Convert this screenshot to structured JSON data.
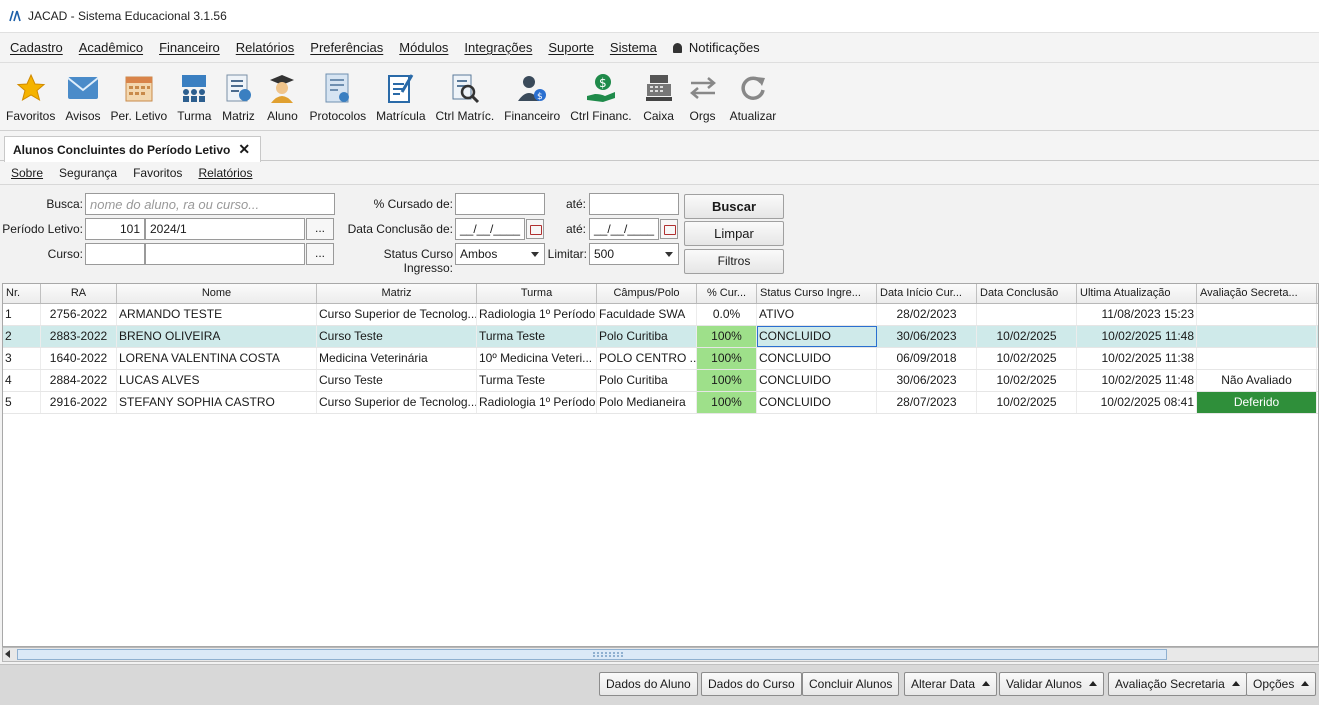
{
  "window": {
    "title": "JACAD - Sistema Educacional 3.1.56"
  },
  "menu": [
    "Cadastro",
    "Acadêmico",
    "Financeiro",
    "Relatórios",
    "Preferências",
    "Módulos",
    "Integrações",
    "Suporte",
    "Sistema"
  ],
  "notifications_label": "Notificações",
  "toolbar": [
    {
      "label": "Favoritos",
      "icon": "star-icon"
    },
    {
      "label": "Avisos",
      "icon": "envelope-icon"
    },
    {
      "label": "Per. Letivo",
      "icon": "calendar-icon"
    },
    {
      "label": "Turma",
      "icon": "class-icon"
    },
    {
      "label": "Matriz",
      "icon": "curriculum-icon"
    },
    {
      "label": "Aluno",
      "icon": "student-icon"
    },
    {
      "label": "Protocolos",
      "icon": "protocol-icon"
    },
    {
      "label": "Matrícula",
      "icon": "enrollment-icon"
    },
    {
      "label": "Ctrl Matríc.",
      "icon": "enrollment-control-icon"
    },
    {
      "label": "Financeiro",
      "icon": "finance-icon"
    },
    {
      "label": "Ctrl Financ.",
      "icon": "finance-control-icon"
    },
    {
      "label": "Caixa",
      "icon": "cash-register-icon"
    },
    {
      "label": "Orgs",
      "icon": "swap-arrows-icon"
    },
    {
      "label": "Atualizar",
      "icon": "refresh-icon"
    }
  ],
  "tab": {
    "label": "Alunos Concluintes do Período Letivo",
    "close": "✕"
  },
  "submenu": [
    "Sobre",
    "Segurança",
    "Favoritos",
    "Relatórios"
  ],
  "filters": {
    "busca_label": "Busca:",
    "busca_placeholder": "nome do aluno, ra ou curso...",
    "periodo_label": "Período Letivo:",
    "periodo_code": "101",
    "periodo_value": "2024/1",
    "curso_label": "Curso:",
    "curso_code": "",
    "curso_value": "",
    "ellipsis": "...",
    "cursado_label": "% Cursado de:",
    "cursado_from": "",
    "ate_label": "até:",
    "cursado_to": "",
    "conclusao_label": "Data Conclusão de:",
    "conclusao_from": "__/__/____",
    "conclusao_to": "__/__/____",
    "status_label": "Status Curso Ingresso:",
    "status_value": "Ambos",
    "limitar_label": "Limitar:",
    "limitar_value": "500"
  },
  "actions": {
    "buscar": "Buscar",
    "limpar": "Limpar",
    "filtros": "Filtros"
  },
  "table": {
    "headers": [
      "Nr.",
      "RA",
      "Nome",
      "Matriz",
      "Turma",
      "Câmpus/Polo",
      "% Cur...",
      "Status Curso Ingre...",
      "Data Início Cur...",
      "Data Conclusão",
      "Ultima Atualização",
      "Avaliação Secreta..."
    ],
    "rows": [
      [
        "1",
        "2756-2022",
        "ARMANDO TESTE",
        "Curso Superior de Tecnolog...",
        "Radiologia 1º Período",
        "Faculdade SWA",
        "0.0%",
        "ATIVO",
        "28/02/2023",
        "",
        "11/08/2023 15:23",
        ""
      ],
      [
        "2",
        "2883-2022",
        "BRENO OLIVEIRA",
        "Curso Teste",
        "Turma Teste",
        "Polo Curitiba",
        "100%",
        "CONCLUIDO",
        "30/06/2023",
        "10/02/2025",
        "10/02/2025 11:48",
        ""
      ],
      [
        "3",
        "1640-2022",
        "LORENA VALENTINA COSTA",
        "Medicina Veterinária",
        "10º  Medicina Veteri...",
        " POLO CENTRO ...",
        "100%",
        "CONCLUIDO",
        "06/09/2018",
        "10/02/2025",
        "10/02/2025 11:38",
        ""
      ],
      [
        "4",
        "2884-2022",
        "LUCAS ALVES",
        "Curso Teste",
        "Turma Teste",
        "Polo Curitiba",
        "100%",
        "CONCLUIDO",
        "30/06/2023",
        "10/02/2025",
        "10/02/2025 11:48",
        "Não Avaliado"
      ],
      [
        "5",
        "2916-2022",
        "STEFANY SOPHIA CASTRO",
        "Curso Superior de Tecnolog...",
        "Radiologia 1º Período",
        "Polo Medianeira",
        "100%",
        "CONCLUIDO",
        "28/07/2023",
        "10/02/2025",
        "10/02/2025 08:41",
        "Deferido"
      ]
    ],
    "selected_row": 2
  },
  "bottom_buttons": [
    "Dados do Aluno",
    "Dados do Curso",
    "Concluir Alunos",
    "Alterar Data",
    "Validar Alunos",
    "Avaliação Secretaria",
    "Opções"
  ],
  "colors": {
    "selected_row": "#cfeaea",
    "pct_full": "#9ee08a",
    "deferido": "#2f8f3a"
  }
}
